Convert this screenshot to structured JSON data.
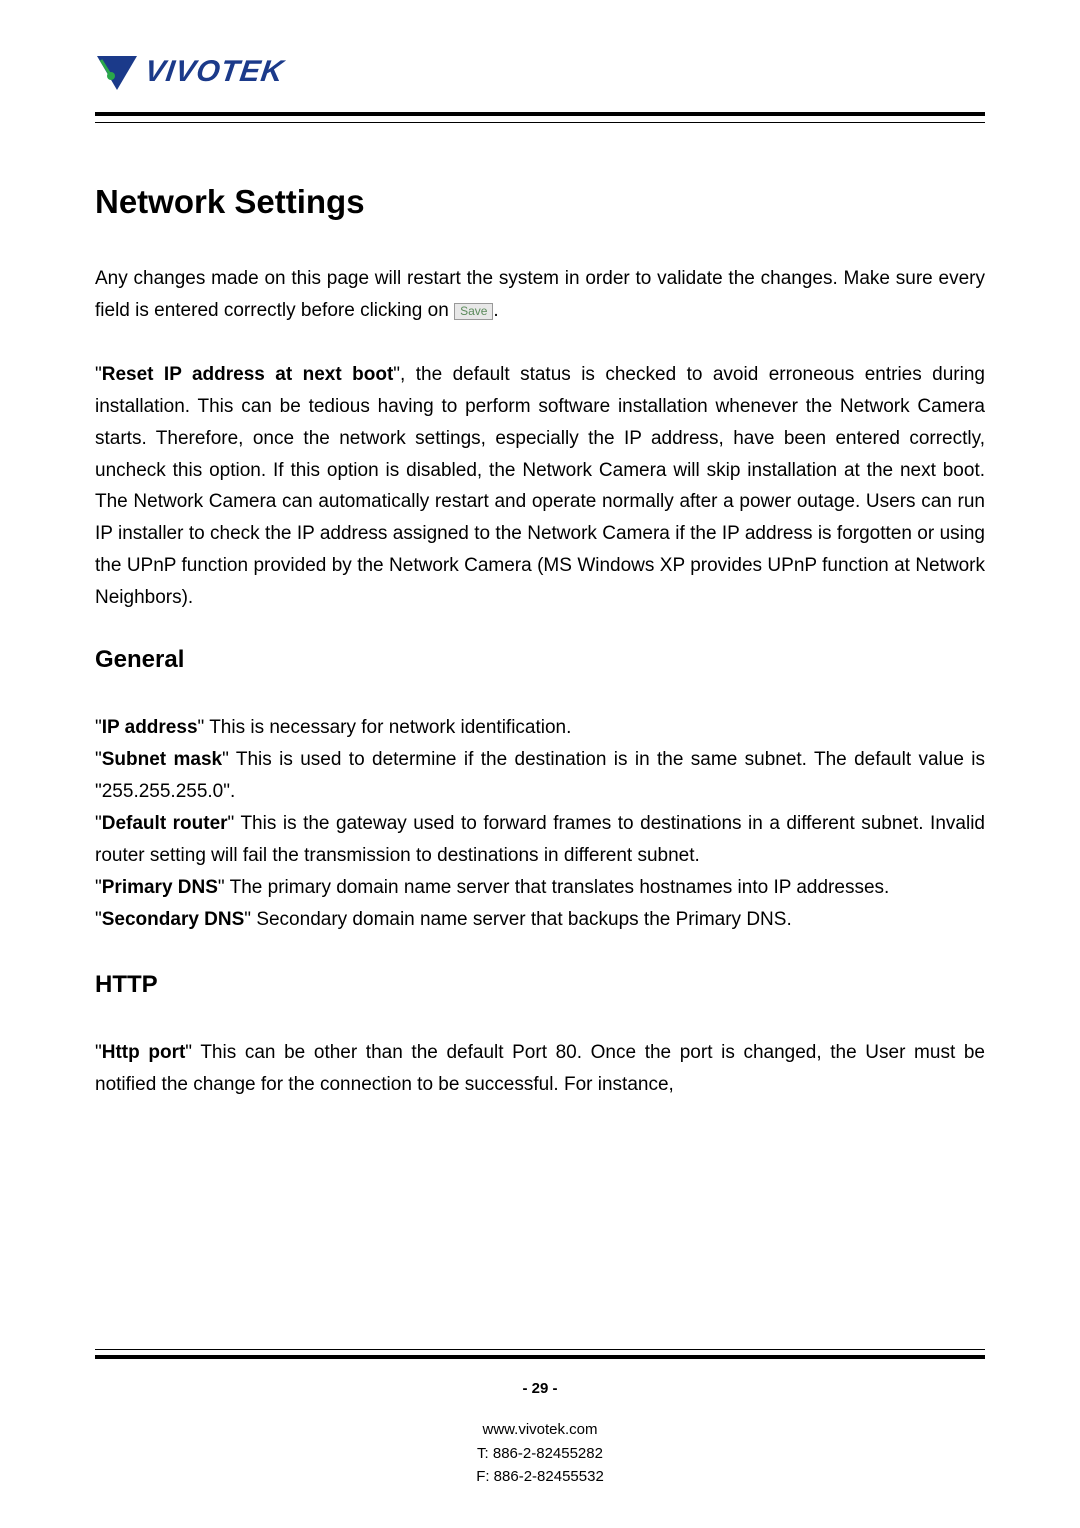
{
  "logo": {
    "text": "VIVOTEK"
  },
  "title": "Network Settings",
  "intro": {
    "pre": "Any changes made on this page will restart the system in order to validate the changes. Make sure every field is entered correctly before clicking on ",
    "button": "Save",
    "post": "."
  },
  "reset": {
    "lead_quote": "\"",
    "lead_bold": "Reset IP address at next boot",
    "rest": "\", the default status is checked to avoid erroneous entries during installation. This can be tedious having to perform software installation whenever the Network Camera starts. Therefore, once the network settings, especially the IP address, have been entered correctly, uncheck this option. If this option is disabled, the Network Camera will skip installation at the next boot.  The Network Camera can automatically restart and operate normally after a power outage.  Users can run IP installer to check the IP address assigned to the Network Camera if the IP address is forgotten or using the UPnP function provided by the Network Camera (MS Windows XP provides UPnP function at Network Neighbors)."
  },
  "general": {
    "heading": "General",
    "items": [
      {
        "term": "IP address",
        "desc": "\" This is necessary for network identification."
      },
      {
        "term": "Subnet mask",
        "desc": "\" This is used to determine if the destination is in the same subnet. The default value is \"255.255.255.0\"."
      },
      {
        "term": "Default router",
        "desc": "\" This is the gateway used to forward frames to destinations in a different subnet. Invalid router setting will fail the transmission to destinations in different subnet."
      },
      {
        "term": "Primary DNS",
        "desc": "\" The primary domain name server that translates hostnames into IP addresses."
      },
      {
        "term": "Secondary DNS",
        "desc": "\" Secondary domain name server that backups the Primary DNS."
      }
    ]
  },
  "http": {
    "heading": "HTTP",
    "items": [
      {
        "term": "Http port",
        "desc": "\" This can be other than the default Port 80. Once the port is changed, the User must be notified the change for the connection to be successful. For instance,"
      }
    ]
  },
  "footer": {
    "page": "- 29 -",
    "url": "www.vivotek.com",
    "tel": "T: 886-2-82455282",
    "fax": "F: 886-2-82455532"
  }
}
